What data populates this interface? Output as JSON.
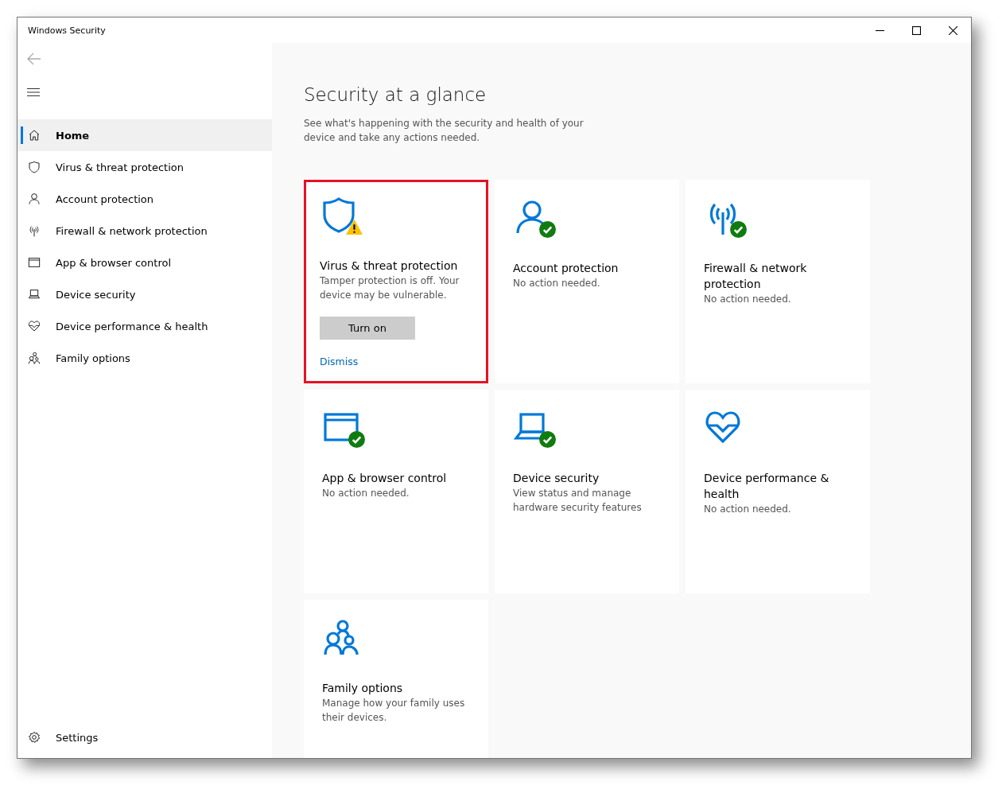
{
  "window": {
    "title": "Windows Security"
  },
  "sidebar": {
    "items": [
      {
        "kind": "home",
        "label": "Home",
        "selected": true
      },
      {
        "kind": "shield",
        "label": "Virus & threat protection",
        "selected": false
      },
      {
        "kind": "person",
        "label": "Account protection",
        "selected": false
      },
      {
        "kind": "antenna",
        "label": "Firewall & network protection",
        "selected": false
      },
      {
        "kind": "window",
        "label": "App & browser control",
        "selected": false
      },
      {
        "kind": "laptop",
        "label": "Device security",
        "selected": false
      },
      {
        "kind": "heart",
        "label": "Device performance & health",
        "selected": false
      },
      {
        "kind": "family",
        "label": "Family options",
        "selected": false
      }
    ],
    "settings": {
      "kind": "gear",
      "label": "Settings",
      "selected": false
    }
  },
  "main": {
    "heading": "Security at a glance",
    "subtitle": "See what's happening with the security and health of your device and take any actions needed.",
    "cards": [
      {
        "kind": "shield",
        "warning": true,
        "verified": false,
        "highlighted": true,
        "title": "Virus & threat protection",
        "description": "Tamper protection is off. Your device may be vulnerable.",
        "button": "Turn on",
        "link": "Dismiss"
      },
      {
        "kind": "person",
        "warning": false,
        "verified": true,
        "highlighted": false,
        "title": "Account protection",
        "description": "No action needed."
      },
      {
        "kind": "antenna",
        "warning": false,
        "verified": true,
        "highlighted": false,
        "title": "Firewall & network protection",
        "description": "No action needed."
      },
      {
        "kind": "window",
        "warning": false,
        "verified": true,
        "highlighted": false,
        "title": "App & browser control",
        "description": "No action needed."
      },
      {
        "kind": "laptop",
        "warning": false,
        "verified": true,
        "highlighted": false,
        "title": "Device security",
        "description": "View status and manage hardware security features"
      },
      {
        "kind": "heart",
        "warning": false,
        "verified": false,
        "highlighted": false,
        "title": "Device performance & health",
        "description": "No action needed."
      },
      {
        "kind": "family",
        "warning": false,
        "verified": false,
        "highlighted": false,
        "title": "Family options",
        "description": "Manage how your family uses their devices."
      }
    ]
  }
}
